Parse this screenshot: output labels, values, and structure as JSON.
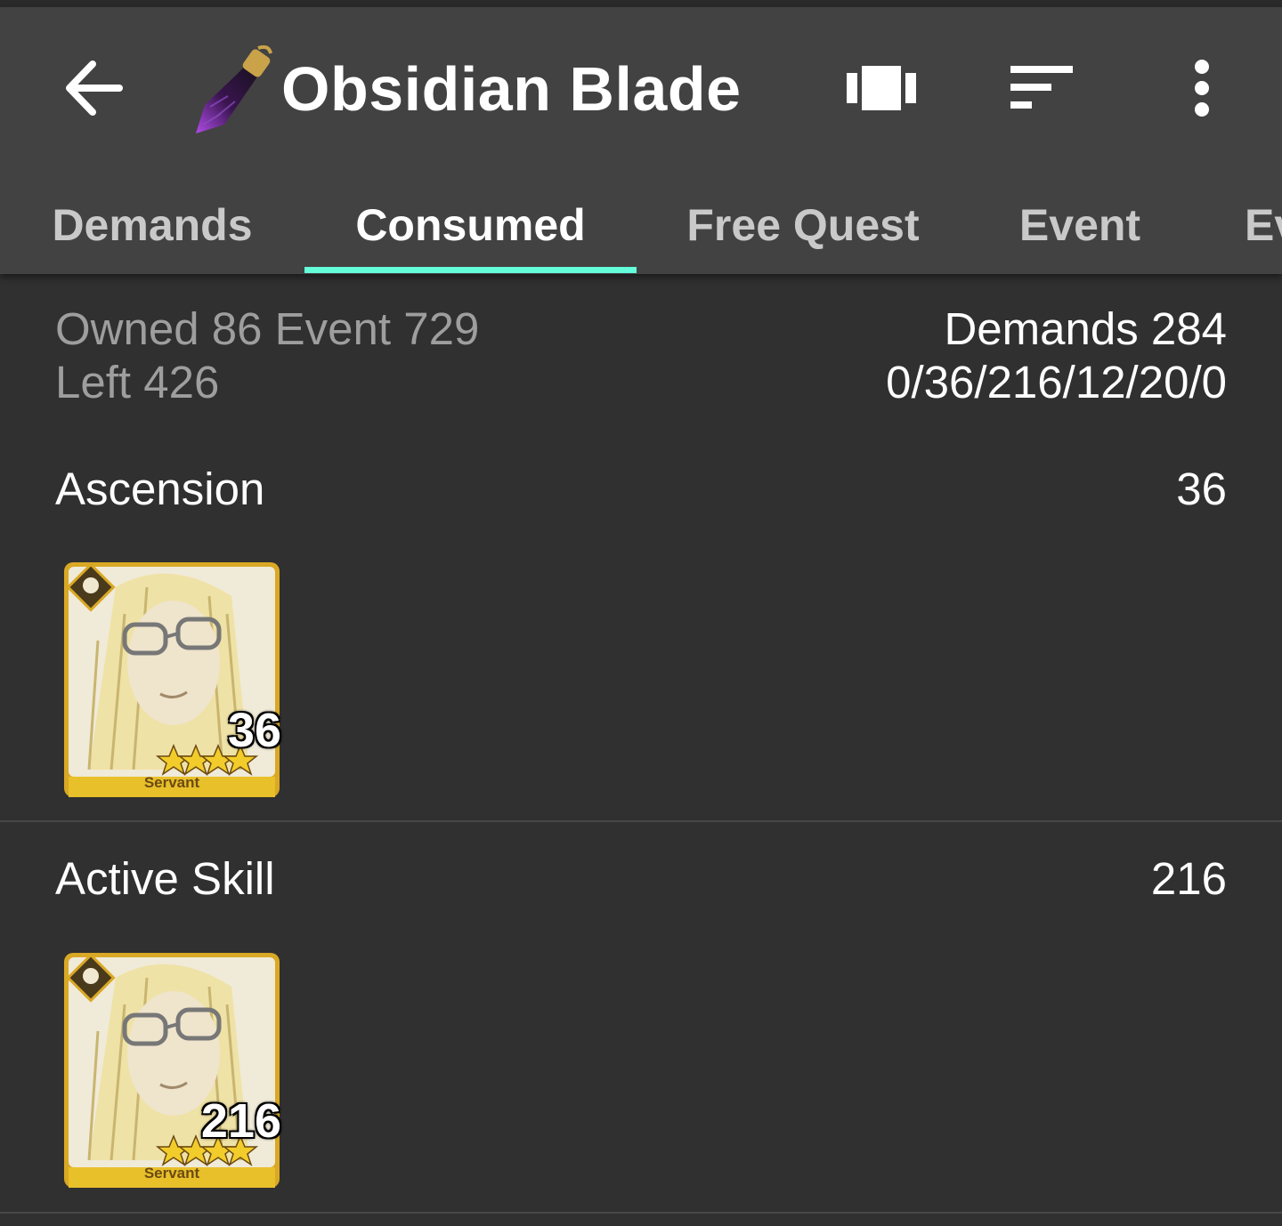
{
  "header": {
    "title": "Obsidian Blade",
    "back_icon": "arrow-back-icon",
    "item_icon": "obsidian-blade-item-icon",
    "actions": [
      "view-carousel-icon",
      "sort-icon",
      "more-vert-icon"
    ]
  },
  "tabs": [
    {
      "label": "Demands",
      "active": false
    },
    {
      "label": "Consumed",
      "active": true
    },
    {
      "label": "Free Quest",
      "active": false
    },
    {
      "label": "Event",
      "active": false
    },
    {
      "label": "Ev",
      "active": false
    }
  ],
  "summary": {
    "line1": "Owned 86 Event 729",
    "line2": "Left 426",
    "demands": "Demands 284",
    "breakdown": "0/36/216/12/20/0"
  },
  "sections": [
    {
      "title": "Ascension",
      "count": "36",
      "cards": [
        {
          "count": "36",
          "label": "Servant",
          "stars": 4
        }
      ]
    },
    {
      "title": "Active Skill",
      "count": "216",
      "cards": [
        {
          "count": "216",
          "label": "Servant",
          "stars": 4
        }
      ]
    }
  ],
  "colors": {
    "appbar": "#424242",
    "background": "#303030",
    "accent": "#64ffda",
    "card_gold": "#e8c02a"
  }
}
